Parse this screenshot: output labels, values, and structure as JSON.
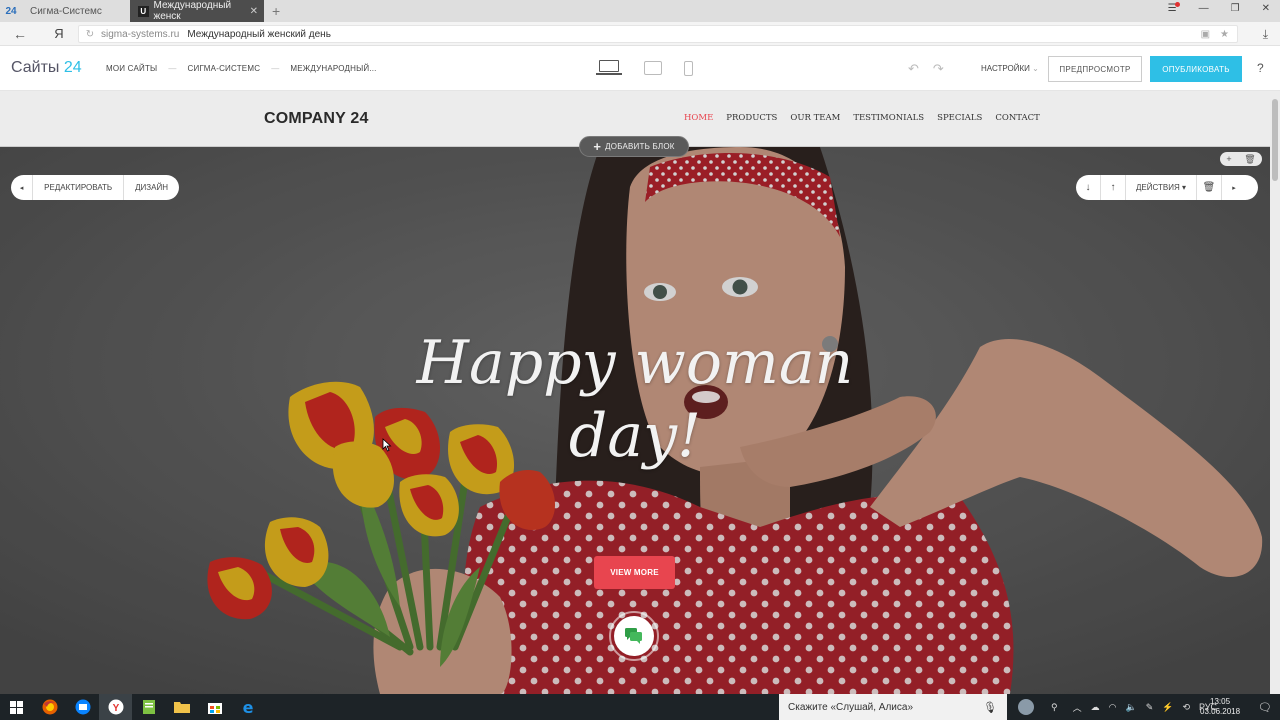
{
  "browser": {
    "logo": "24",
    "tabs": [
      {
        "label": "Сигма-Системс"
      },
      {
        "label": "Международный женск",
        "favicon": "U"
      }
    ],
    "yandex_button": "Я",
    "url_domain": "sigma-systems.ru",
    "url_title": "Международный женский день"
  },
  "editor": {
    "brand": "Сайты",
    "brand_num": "24",
    "breadcrumbs": [
      "МОИ САЙТЫ",
      "СИГМА-СИСТЕМС",
      "МЕЖДУНАРОДНЫЙ..."
    ],
    "settings": "НАСТРОЙКИ",
    "preview": "ПРЕДПРОСМОТР",
    "publish": "ОПУБЛИКОВАТЬ",
    "help": "?",
    "accent": "#2ebfe6"
  },
  "site": {
    "company": "COMPANY 24",
    "nav": [
      {
        "label": "HOME",
        "active": true
      },
      {
        "label": "PRODUCTS"
      },
      {
        "label": "OUR TEAM"
      },
      {
        "label": "TESTIMONIALS"
      },
      {
        "label": "SPECIALS"
      },
      {
        "label": "CONTACT"
      }
    ],
    "accent": "#e8454f"
  },
  "block_tools": {
    "add_block": "ДОБАВИТЬ БЛОК",
    "edit": "РЕДАКТИРОВАТЬ",
    "design": "ДИЗАЙН",
    "actions": "ДЕЙСТВИЯ"
  },
  "hero": {
    "title_line1": "Happy woman",
    "title_line2": "day!",
    "button": "VIEW MORE"
  },
  "taskbar": {
    "alice_placeholder": "Скажите «Слушай, Алиса»",
    "lang": "РУС",
    "time": "13:05",
    "date": "03.06.2018"
  }
}
